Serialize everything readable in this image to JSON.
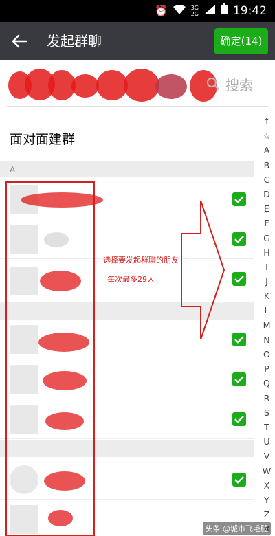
{
  "status_bar": {
    "time": "19:42",
    "network_label_top": "3G",
    "network_label_bottom": "2G"
  },
  "header": {
    "title": "发起群聊",
    "confirm_label": "确定(14)"
  },
  "search": {
    "placeholder": "搜索"
  },
  "face_to_face": {
    "label": "面对面建群"
  },
  "section_header": "A",
  "contacts_visible": [
    {
      "checked": true
    },
    {
      "checked": true
    },
    {
      "checked": true
    },
    {
      "checked": true
    },
    {
      "checked": true
    },
    {
      "checked": true
    },
    {
      "checked": true
    }
  ],
  "annotation": {
    "line1": "选择要发起群聊的朋友",
    "line2": "每次最多29人"
  },
  "index_letters": [
    "↑",
    "☆",
    "A",
    "B",
    "C",
    "D",
    "E",
    "F",
    "G",
    "H",
    "I",
    "J",
    "K",
    "L",
    "M",
    "N",
    "O",
    "P",
    "Q",
    "R",
    "S",
    "T",
    "U",
    "V",
    "W",
    "X",
    "Y",
    "Z",
    "#"
  ],
  "watermark": "头条 @城市飞毛腿",
  "colors": {
    "accent_green": "#1aad19",
    "header_bg": "#393a3f",
    "annotation_red": "#d4201e"
  }
}
